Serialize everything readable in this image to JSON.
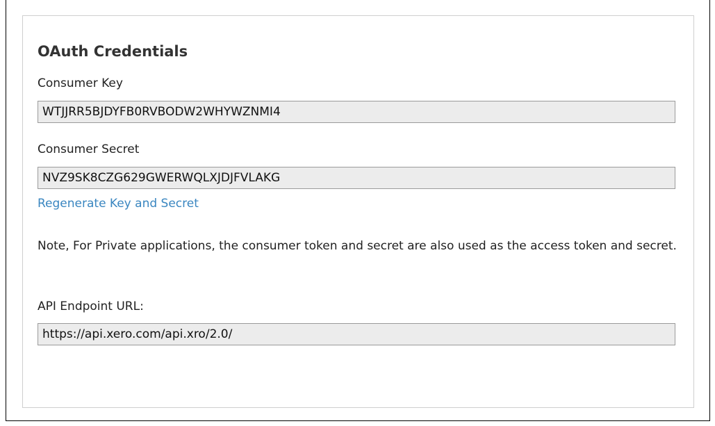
{
  "panel": {
    "title": "OAuth Credentials"
  },
  "consumer_key": {
    "label": "Consumer Key",
    "value": "WTJJRR5BJDYFB0RVBODW2WHYWZNMI4"
  },
  "consumer_secret": {
    "label": "Consumer Secret",
    "value": "NVZ9SK8CZG629GWERWQLXJDJFVLAKG"
  },
  "regenerate_link": "Regenerate Key and Secret",
  "note": "Note, For Private applications, the consumer token and secret are also used as the access token and secret.",
  "api_endpoint": {
    "label": "API Endpoint URL:",
    "value": "https://api.xero.com/api.xro/2.0/"
  },
  "colors": {
    "link": "#3a86c0",
    "field_background": "#ececec",
    "field_border": "#9a9a9a",
    "panel_border": "#cfcfcf"
  }
}
